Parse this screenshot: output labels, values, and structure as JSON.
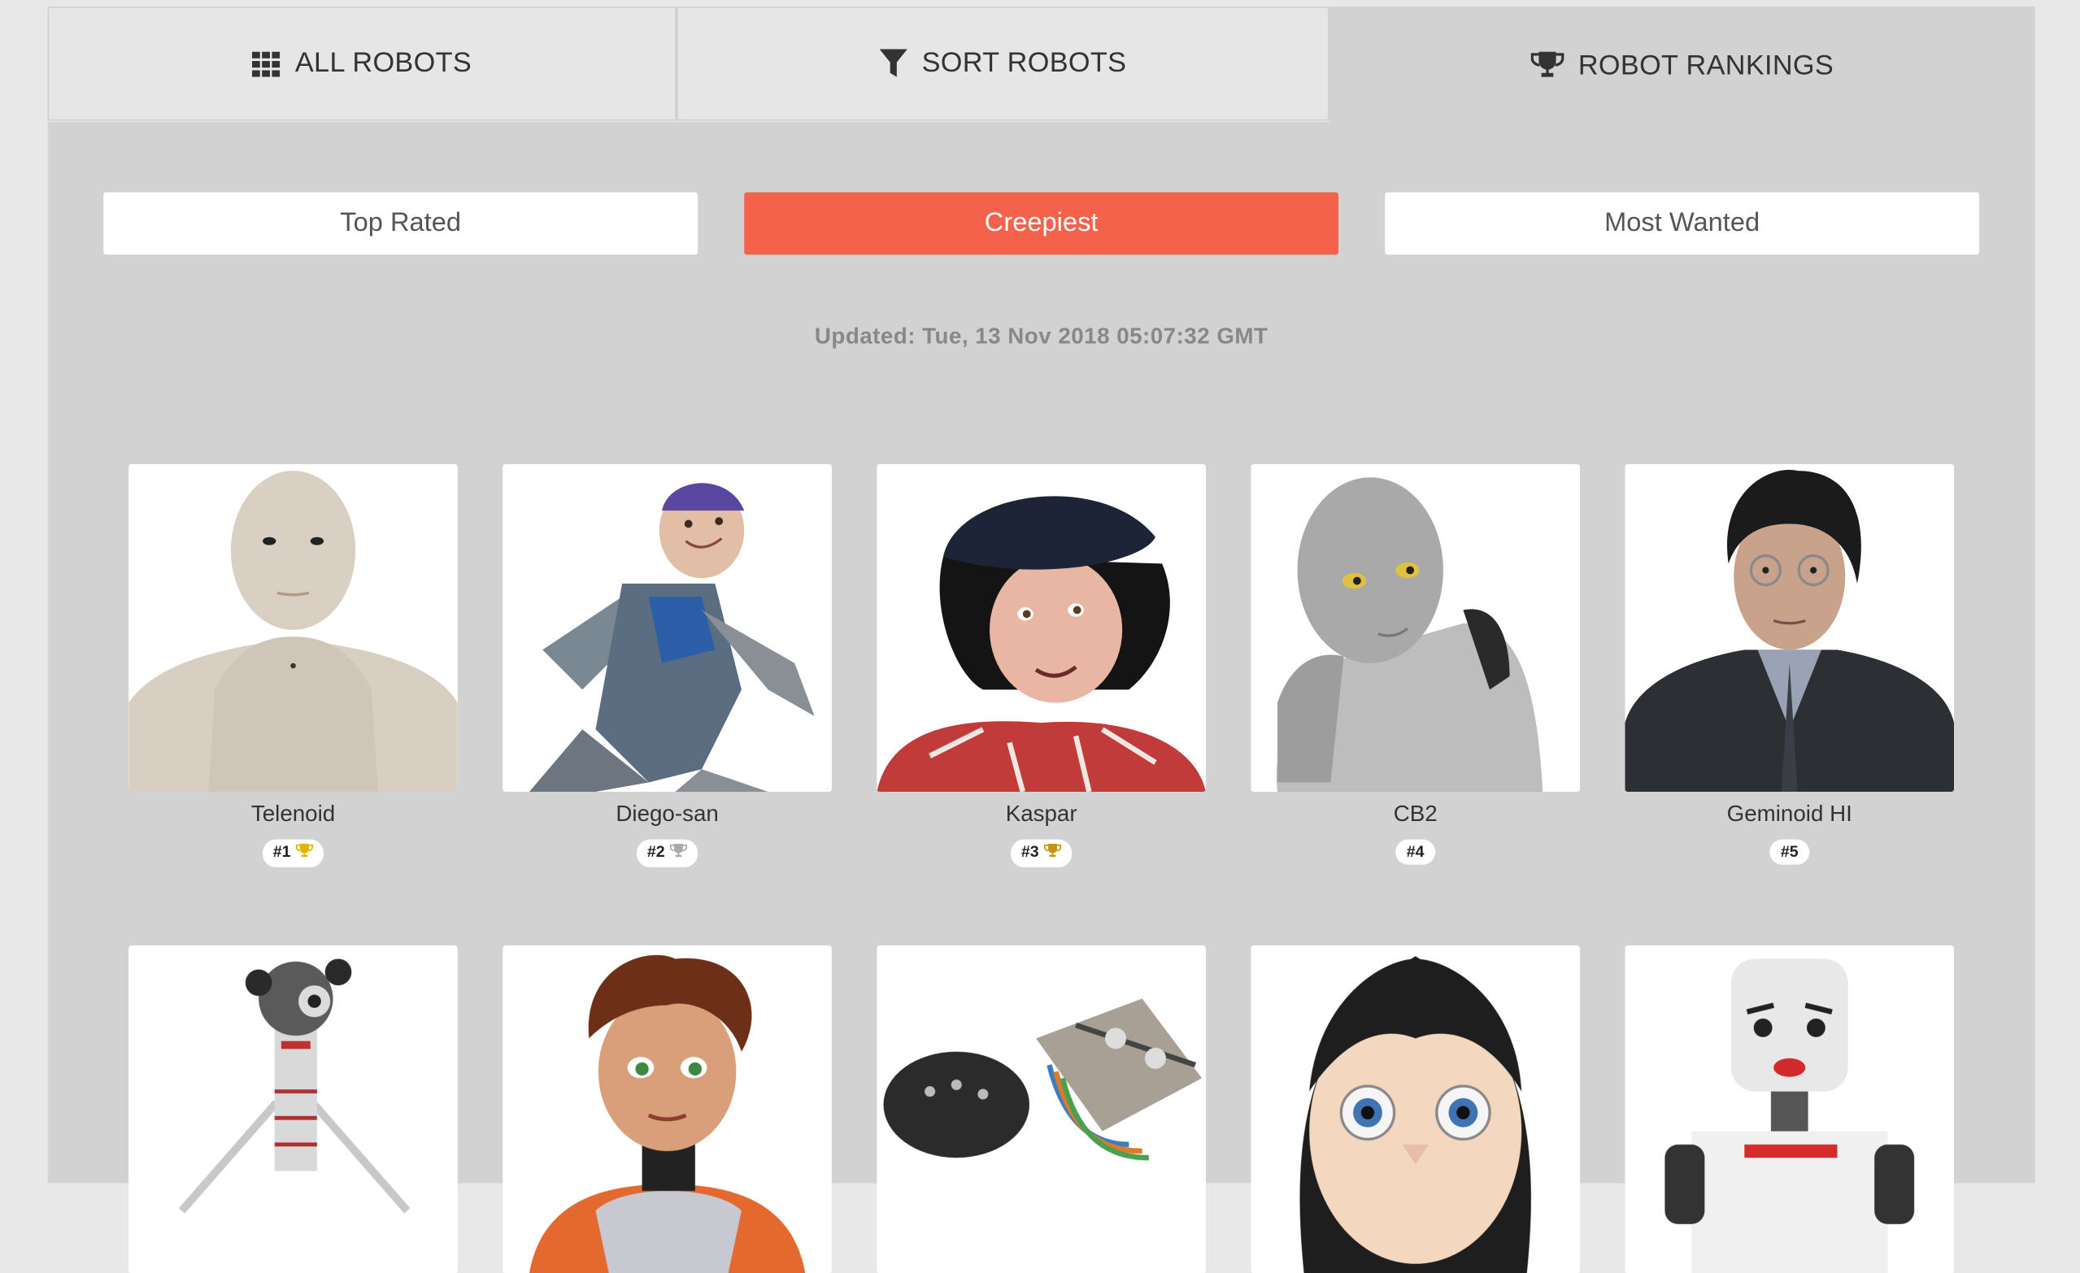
{
  "tabs": [
    {
      "label": "ALL ROBOTS",
      "icon": "grid-icon"
    },
    {
      "label": "SORT ROBOTS",
      "icon": "filter-icon"
    },
    {
      "label": "ROBOT RANKINGS",
      "icon": "trophy-icon",
      "active": true
    }
  ],
  "subtabs": [
    {
      "label": "Top Rated"
    },
    {
      "label": "Creepiest",
      "active": true
    },
    {
      "label": "Most Wanted"
    }
  ],
  "updated": "Updated: Tue, 13 Nov 2018 05:07:32 GMT",
  "robots": [
    {
      "name": "Telenoid",
      "rank": "#1",
      "trophy": "gold"
    },
    {
      "name": "Diego-san",
      "rank": "#2",
      "trophy": "silver"
    },
    {
      "name": "Kaspar",
      "rank": "#3",
      "trophy": "bronze"
    },
    {
      "name": "CB2",
      "rank": "#4"
    },
    {
      "name": "Geminoid HI",
      "rank": "#5"
    }
  ],
  "colors": {
    "accent": "#f5624b",
    "panel": "#d2d2d2",
    "gold": "#e2b300",
    "silver": "#a9a9a9",
    "bronze": "#c8930f"
  }
}
